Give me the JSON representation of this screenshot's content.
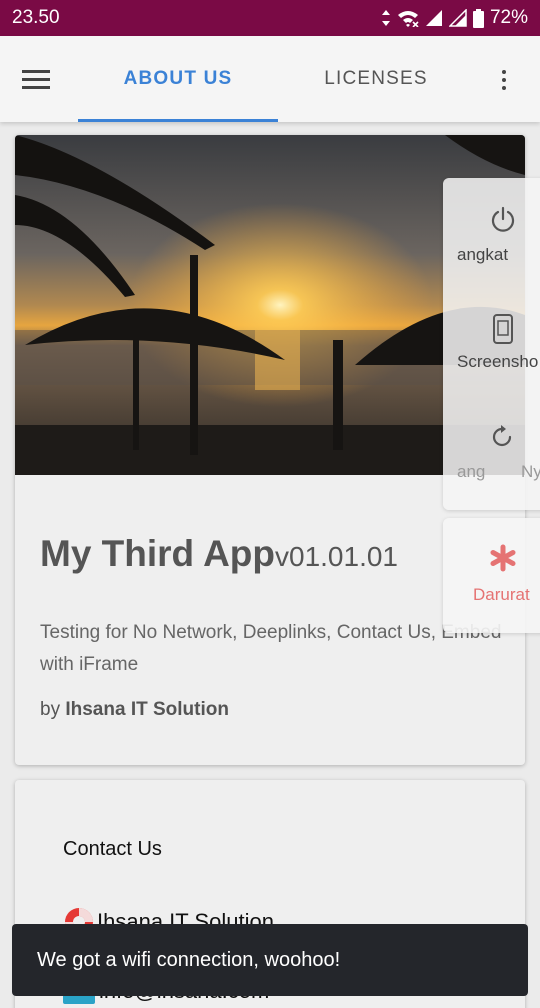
{
  "status_bar": {
    "time": "23.50",
    "battery": "72%",
    "background": "#7a0a45"
  },
  "app_bar": {
    "menu_icon": "hamburger-menu-icon",
    "tabs": [
      {
        "label": "ABOUT US",
        "active": true
      },
      {
        "label": "LICENSES",
        "active": false
      }
    ],
    "overflow_icon": "more-vert-icon",
    "accent": "#3b82d6"
  },
  "about_card": {
    "app_name": "My Third App",
    "version": "v01.01.01",
    "description": "Testing for No Network, Deeplinks, Contact Us, Embed with iFrame",
    "by_prefix": "by",
    "author": "Ihsana IT Solution"
  },
  "contact_card": {
    "title": "Contact Us",
    "company": "Ihsana IT Solution",
    "email": "info@ihsana.com"
  },
  "power_menu": {
    "items": [
      {
        "label": "angkat",
        "icon": "power-icon"
      },
      {
        "label": "Screensho",
        "icon": "screenshot-icon"
      },
      {
        "label": "ang",
        "label2": "Ny",
        "icon": "restart-icon"
      }
    ],
    "emergency": {
      "label": "Darurat",
      "icon": "emergency-asterisk-icon",
      "color": "#e57373"
    }
  },
  "snackbar": {
    "message": "We got a wifi connection, woohoo!"
  }
}
